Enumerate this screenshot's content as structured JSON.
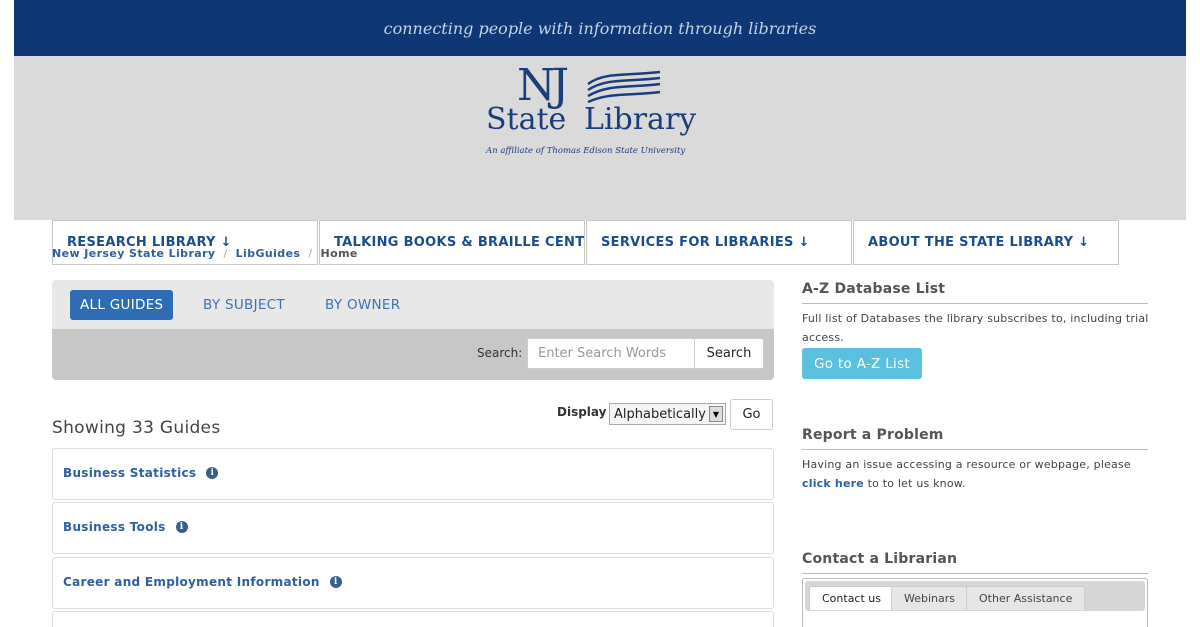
{
  "header": {
    "tagline": "connecting people with information through libraries",
    "logo": {
      "nj": "NJ",
      "state": "State",
      "library": "Library",
      "affiliate": "An affiliate of Thomas Edison State University"
    },
    "nav": [
      "RESEARCH LIBRARY ↓",
      "TALKING BOOKS & BRAILLE CENTER ↓",
      "SERVICES FOR LIBRARIES ↓",
      "ABOUT THE STATE LIBRARY ↓"
    ]
  },
  "breadcrumb": [
    "New Jersey State Library",
    "LibGuides",
    "Home"
  ],
  "guide_tabs": [
    "ALL GUIDES",
    "BY SUBJECT",
    "BY OWNER"
  ],
  "search": {
    "label": "Search:",
    "placeholder": "Enter Search Words",
    "button": "Search"
  },
  "display": {
    "label": "Display",
    "selected": "Alphabetically",
    "go": "Go"
  },
  "showing": "Showing 33 Guides",
  "guides": [
    "Business Statistics",
    "Business Tools",
    "Career and Employment Information"
  ],
  "sidebar": {
    "az": {
      "heading": "A-Z Database List",
      "text": "Full list of Databases the library subscribes to, including trial access.",
      "button": "Go to A-Z List"
    },
    "problem": {
      "heading": "Report a Problem",
      "text_before": "Having an issue accessing a resource or webpage,  please ",
      "link": "click here",
      "text_after": " to to let us know."
    },
    "contact": {
      "heading": "Contact a Librarian",
      "tabs": [
        "Contact us",
        "Webinars",
        "Other Assistance"
      ]
    }
  },
  "colors": {
    "tagline_bg": "#0f3675",
    "header_bg": "#dadada",
    "brand_blue": "#1a3d7c",
    "active_tab": "#2e6db4",
    "az_button": "#5bc0de"
  },
  "icons": [
    "info-icon",
    "select-arrow-icon"
  ]
}
